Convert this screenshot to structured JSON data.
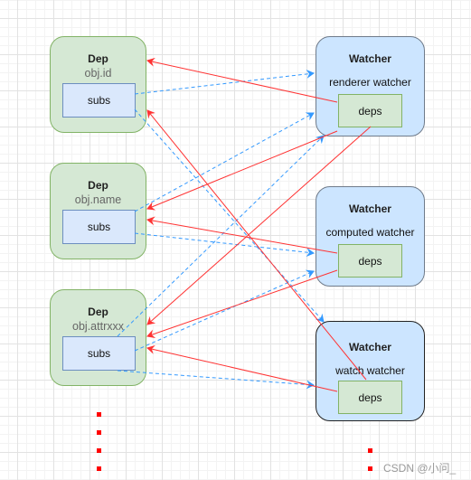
{
  "colors": {
    "red_edge": "#ff3333",
    "blue_edge": "#3399ff"
  },
  "deps": [
    {
      "title": "Dep",
      "name": "obj.id",
      "subs": "subs"
    },
    {
      "title": "Dep",
      "name": "obj.name",
      "subs": "subs"
    },
    {
      "title": "Dep",
      "name": "obj.attrxxx",
      "subs": "subs"
    }
  ],
  "watchers": [
    {
      "title": "Watcher",
      "name": "renderer watcher",
      "deps": "deps"
    },
    {
      "title": "Watcher",
      "name": "computed watcher",
      "deps": "deps"
    },
    {
      "title": "Watcher",
      "name": "watch watcher",
      "deps": "deps"
    }
  ],
  "watermark": "CSDN @小问_"
}
